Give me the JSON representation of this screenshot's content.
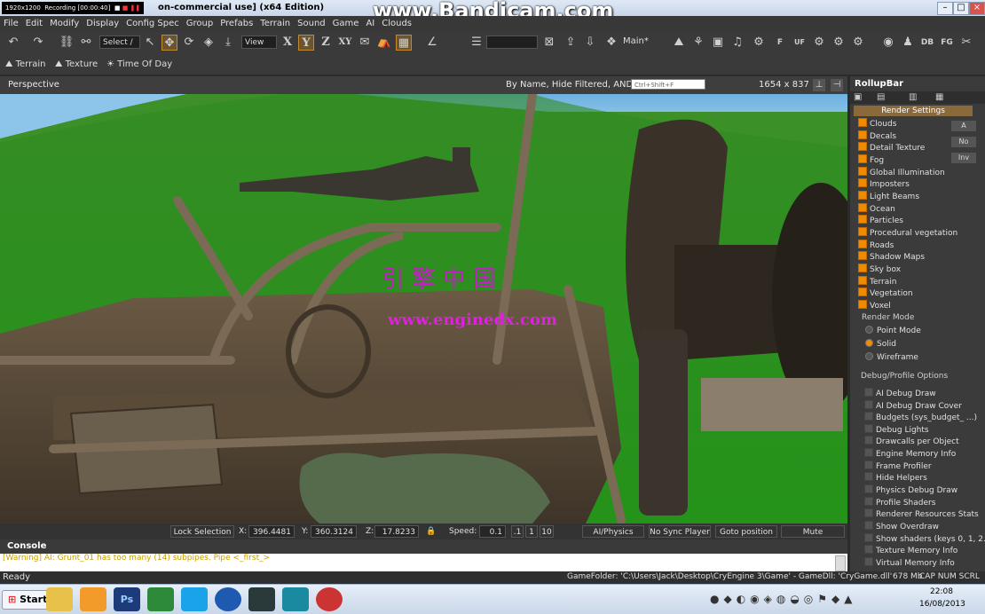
{
  "recorder": {
    "resolution": "1920x1200",
    "status": "Recording [00:00:40]"
  },
  "window": {
    "title": "on-commercial use] (x64 Edition)",
    "watermark": "www.Bandicam.com"
  },
  "menu": [
    "File",
    "Edit",
    "Modify",
    "Display",
    "Config Spec",
    "Group",
    "Prefabs",
    "Terrain",
    "Sound",
    "Game",
    "AI",
    "Clouds"
  ],
  "toolbar": {
    "select_mode": "Select /",
    "view_mode": "View",
    "axis_x": "X",
    "axis_y": "Y",
    "axis_z": "Z",
    "axis_xy": "XY",
    "layer": "Main*",
    "icons_right": [
      "F",
      "UF",
      "DB",
      "FG"
    ]
  },
  "toolbar2": {
    "terrain": "Terrain",
    "texture": "Texture",
    "time_of_day": "Time Of Day"
  },
  "viewport_header": {
    "label": "Perspective",
    "filter": "By Name, Hide Filtered, AND",
    "search_placeholder": "Ctrl+Shift+F",
    "resolution": "1654 x 837"
  },
  "overlay": {
    "chinese": "引  擎  中  国",
    "url": "www.enginedx.com"
  },
  "coords": {
    "lock": "Lock Selection",
    "x_label": "X:",
    "x": "396.4481",
    "y_label": "Y:",
    "y": "360.3124",
    "z_label": "Z:",
    "z": "17.8233",
    "speed_label": "Speed:",
    "speed": "0.1",
    "speed_opts": [
      ".1",
      "1",
      "10"
    ],
    "ai_physics": "AI/Physics",
    "no_sync": "No Sync Player",
    "goto": "Goto position",
    "mute": "Mute"
  },
  "console": {
    "title": "Console",
    "message": "[Warning] AI: Grunt_01 has too many (14) subpipes. Pipe <_first_>"
  },
  "status": {
    "ready": "Ready",
    "info": "GameFolder: 'C:\\Users\\Jack\\Desktop\\CryEngine 3\\Game' - GameDll: 'CryGame.dll'",
    "memory": "678 Mb",
    "keys": "CAP  NUM  SCRL"
  },
  "rollup": {
    "title": "RollupBar",
    "section": "Render Settings",
    "side_buttons": [
      "A",
      "No",
      "Inv"
    ],
    "render_items": [
      "Clouds",
      "Decals",
      "Detail Texture",
      "Fog",
      "Global Illumination",
      "Imposters",
      "Light Beams",
      "Ocean",
      "Particles",
      "Procedural vegetation",
      "Roads",
      "Shadow Maps",
      "Sky box",
      "Terrain",
      "Vegetation",
      "Voxel"
    ],
    "render_mode_label": "Render Mode",
    "render_modes": [
      "Point Mode",
      "Solid",
      "Wireframe"
    ],
    "render_mode_selected": "Solid",
    "debug_label": "Debug/Profile Options",
    "debug_items": [
      "AI Debug Draw",
      "AI Debug Draw Cover",
      "Budgets (sys_budget_ ...)",
      "Debug Lights",
      "Drawcalls per Object",
      "Engine Memory Info",
      "Frame Profiler",
      "Hide Helpers",
      "Physics Debug Draw",
      "Profile Shaders",
      "Renderer Resources Stats",
      "Show Overdraw",
      "Show shaders (keys 0, 1, 2...",
      "Texture Memory Info",
      "Virtual Memory Info"
    ]
  },
  "taskbar": {
    "start": "Start",
    "time": "22:08",
    "date": "16/08/2013"
  }
}
